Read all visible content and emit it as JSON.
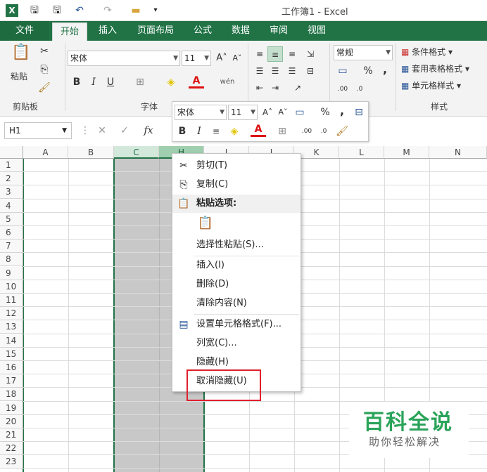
{
  "app": {
    "title": "工作簿1 - Excel",
    "logo": "X"
  },
  "ribbon_tabs": [
    "文件",
    "开始",
    "插入",
    "页面布局",
    "公式",
    "数据",
    "审阅",
    "视图"
  ],
  "ribbon": {
    "clipboard": {
      "paste": "粘贴",
      "label": "剪贴板"
    },
    "font": {
      "name": "宋体",
      "size": "11",
      "bold": "B",
      "italic": "I",
      "underline": "U",
      "label": "字体"
    },
    "number": {
      "format": "常规",
      "percent": "%",
      "comma": ","
    },
    "styles": {
      "conditional": "条件格式",
      "table": "套用表格格式",
      "cell": "单元格样式",
      "label": "样式"
    }
  },
  "formula": {
    "name_box": "H1",
    "fx": "fx"
  },
  "columns": [
    "A",
    "B",
    "C",
    "H",
    "I",
    "J",
    "K",
    "L",
    "M",
    "N"
  ],
  "rows": [
    "1",
    "2",
    "3",
    "4",
    "5",
    "6",
    "7",
    "8",
    "9",
    "10",
    "11",
    "12",
    "13",
    "14",
    "15",
    "16",
    "17",
    "18",
    "19",
    "20",
    "21",
    "22",
    "23"
  ],
  "mini_toolbar": {
    "font": "宋体",
    "size": "11",
    "bold": "B",
    "italic": "I",
    "percent": "%",
    "comma": ","
  },
  "context_menu": {
    "cut": "剪切(T)",
    "copy": "复制(C)",
    "paste_options": "粘贴选项:",
    "paste_special": "选择性粘贴(S)...",
    "insert": "插入(I)",
    "delete": "删除(D)",
    "clear": "清除内容(N)",
    "format_cells": "设置单元格格式(F)...",
    "col_width": "列宽(C)...",
    "hide": "隐藏(H)",
    "unhide": "取消隐藏(U)"
  },
  "watermark": {
    "title": "百科全说",
    "subtitle": "助你轻松解决"
  },
  "colors": {
    "accent": "#217346",
    "selection": "#c8c8c8",
    "highlight": "#e0202e"
  }
}
